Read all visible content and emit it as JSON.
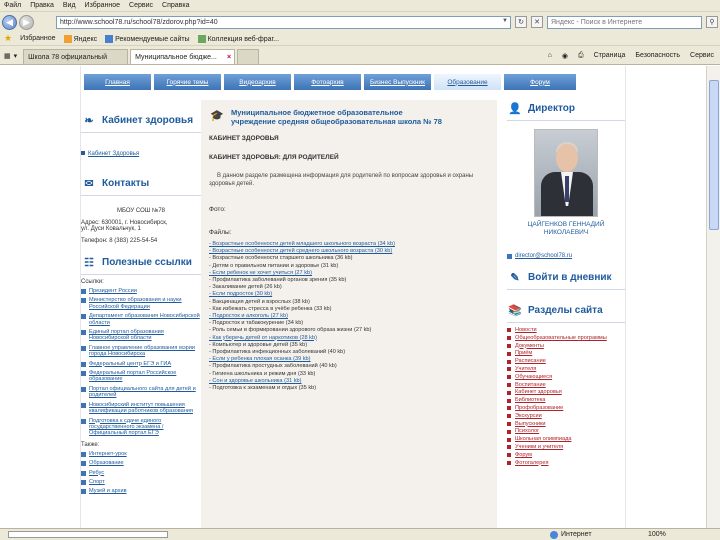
{
  "browser": {
    "menu": [
      "Файл",
      "Правка",
      "Вид",
      "Избранное",
      "Сервис",
      "Справка"
    ],
    "address": "http://www.school78.ru/school78/zdorov.php?id=40",
    "search_placeholder": "Яндекс - Поиск в Интернете",
    "favorites": [
      {
        "label": "Избранное"
      },
      {
        "label": "Яндекс"
      },
      {
        "label": "Рекомендуемые сайты"
      },
      {
        "label": "Коллекция веб-фраг..."
      }
    ],
    "tabs": [
      {
        "label": "Школа 78 официальный"
      },
      {
        "label": "Муниципальное бюдже..."
      }
    ],
    "tab_tools": [
      "Страница",
      "Безопасность",
      "Сервис"
    ],
    "status": {
      "zone": "Интернет",
      "zoom": "100%"
    }
  },
  "site": {
    "nav": [
      {
        "label": "Главная"
      },
      {
        "label": "Горячие темы"
      },
      {
        "label": "Видеоархив"
      },
      {
        "label": "Фотоархив"
      },
      {
        "label": "Бизнес Выпускник"
      },
      {
        "label": "Образование"
      },
      {
        "label": "Форум"
      }
    ],
    "left": {
      "health_title": "Кабинет здоровья",
      "health_link": "Кабинет Здоровья",
      "contacts_title": "Контакты",
      "school_short": "МБОУ СОШ №78",
      "address_line1": "Адрес: 630001, г. Новосибирск,",
      "address_line2": "ул. Дуси Ковальчук, 1",
      "phone": "Телефон: 8 (383) 225-54-54",
      "links_title": "Полезные ссылки",
      "links_sub": "Ссылки:",
      "links": [
        "Президент России",
        "Министерство образования и науки Российской Федерации",
        "Департамент образования Новосибирской области",
        "Единый портал образования Новосибирской области",
        "Главное управление образования мэрии города Новосибирска",
        "Федеральный центр ЕГЭ и ГИА",
        "Федеральный портал Российское образование",
        "Портал официального сайта для детей и родителей",
        "Новосибирский институт повышения квалификации работников образования",
        "Подготовка к сдаче единого государственного экзамена / Официальный портал ЕГЭ"
      ],
      "other_sub": "Также:",
      "other": [
        "Интернет-урок",
        "Образование",
        "Ребус",
        "Спорт",
        "Музей и архив"
      ]
    },
    "center": {
      "school_name_line1": "Муниципальное бюджетное образовательное",
      "school_name_line2": "учреждение средняя общеобразовательная школа № 78",
      "head1": "КАБИНЕТ ЗДОРОВЬЯ",
      "head2": "КАБИНЕТ ЗДОРОВЬЯ: ДЛЯ РОДИТЕЛЕЙ",
      "para": "В данном разделе размещена информация для родителей по вопросам здоровья и охраны здоровья детей.",
      "photo_label": "Фото:",
      "files_label": "Файлы:",
      "files": [
        {
          "text": "Возрастные особенности детей младшего школьного возраста (34 kb)",
          "link": true
        },
        {
          "text": "Возрастные особенности детей среднего школьного возраста (30 kb)",
          "link": true
        },
        {
          "text": "Возрастные особенности старшего школьника (36 kb)",
          "link": false
        },
        {
          "text": "Детям о правильном питании и здоровье (31 kb)",
          "link": false
        },
        {
          "text": "Если ребенок не хочет учиться (27 kb)",
          "link": true
        },
        {
          "text": "Профилактика заболеваний органов зрения (35 kb)",
          "link": false
        },
        {
          "text": "Закаливание детей (26 kb)",
          "link": false
        },
        {
          "text": "Если подросток (30 kb)",
          "link": true
        },
        {
          "text": "Вакцинация детей и взрослых (38 kb)",
          "link": false
        },
        {
          "text": "Как избежать стресса в учёбе ребенка (33 kb)",
          "link": false
        },
        {
          "text": "Подросток и алкоголь (27 kb)",
          "link": true
        },
        {
          "text": "Подросток и табакокурение (34 kb)",
          "link": false
        },
        {
          "text": "Роль семьи в формировании здорового образа жизни (27 kb)",
          "link": false
        },
        {
          "text": "Как уберечь детей от наркотиков (28 kb)",
          "link": true
        },
        {
          "text": "Компьютер и здоровье детей (35 kb)",
          "link": false
        },
        {
          "text": "Профилактика инфекционных заболеваний (40 kb)",
          "link": false
        },
        {
          "text": "Если у ребенка плохая осанка (39 kb)",
          "link": true
        },
        {
          "text": "Профилактика простудных заболеваний (40 kb)",
          "link": false
        },
        {
          "text": "Гигиена школьника и режим дня (33 kb)",
          "link": false
        },
        {
          "text": "Сон и здоровье школьника (31 kb)",
          "link": true
        },
        {
          "text": "Подготовка к экзаменам и отдых (35 kb)",
          "link": false
        }
      ]
    },
    "right": {
      "director_title": "Директор",
      "director_name_line1": "ЦАЙГЕНКОВ ГЕННАДИЙ",
      "director_name_line2": "НИКОЛАЕВИЧ",
      "director_email": "director@school78.ru",
      "diary_title": "Войти в дневник",
      "sections_title": "Разделы сайта",
      "sections": [
        "Новости",
        "Общеобразовательные программы",
        "Документы",
        "Приём",
        "Расписание",
        "Учителя",
        "Обучающиеся",
        "Воспитание",
        "Кабинет здоровья",
        "Библиотека",
        "Профобразование",
        "Экскурсии",
        "Выпускники",
        "Психолог",
        "Школьная олимпиада",
        "Ученики и учителя",
        "Форум",
        "Фотогалерея"
      ]
    }
  }
}
